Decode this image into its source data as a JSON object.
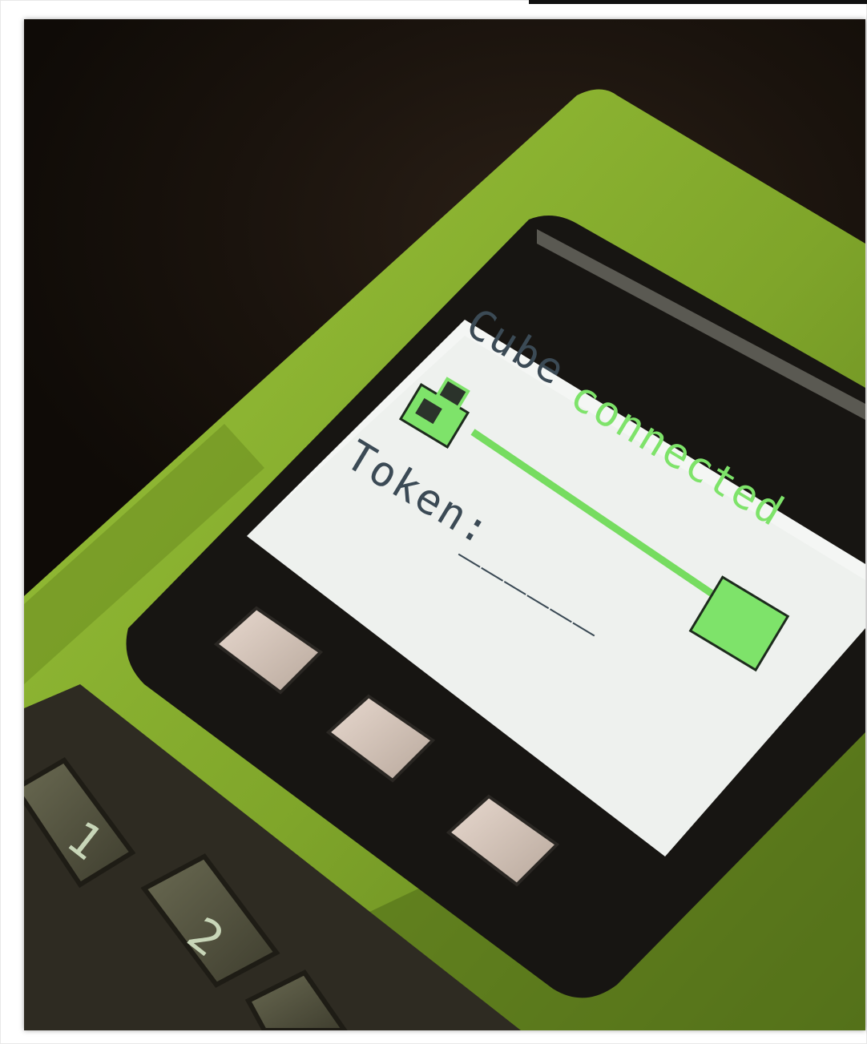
{
  "screen": {
    "title_word": "Cube",
    "status_word": "connected",
    "token_label": "Token:",
    "token_value": "______"
  },
  "device": {
    "keypad_digits": [
      "1",
      "2"
    ],
    "button_count": 3
  },
  "colors": {
    "enclosure": "#8fb834",
    "enclosure_shadow": "#4f6a18",
    "screen_bg": "#eef1ee",
    "accent_green": "#7ee36a",
    "text_dark": "#3b4a55",
    "bezel": "#151412"
  }
}
